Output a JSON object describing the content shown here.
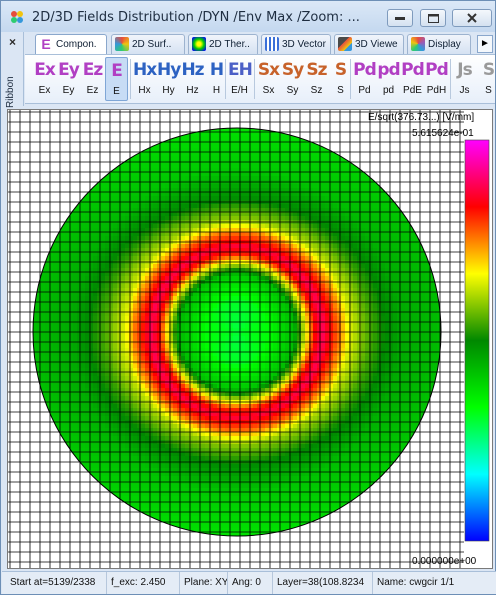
{
  "window": {
    "title": "2D/3D Fields Distribution /DYN /Env Max /Zoom: ..."
  },
  "ribbon": {
    "label": "Ribbon",
    "close": "×",
    "tabs": [
      {
        "label": "Compon.",
        "icon": "e-component-icon",
        "active": true
      },
      {
        "label": "2D Surf..",
        "icon": "surface-2d-icon",
        "active": false
      },
      {
        "label": "2D Ther..",
        "icon": "thermal-2d-icon",
        "active": false
      },
      {
        "label": "3D Vector",
        "icon": "vector-3d-icon",
        "active": false
      },
      {
        "label": "3D Viewe",
        "icon": "viewer-3d-icon",
        "active": false
      },
      {
        "label": "Display",
        "icon": "display-icon",
        "active": false
      }
    ],
    "tab_scroll": "►",
    "buttons": [
      {
        "glyph": "Ex",
        "label": "Ex",
        "kind": "e",
        "selected": false
      },
      {
        "glyph": "Ey",
        "label": "Ey",
        "kind": "e",
        "selected": false
      },
      {
        "glyph": "Ez",
        "label": "Ez",
        "kind": "e",
        "selected": false
      },
      {
        "glyph": "E",
        "label": "E",
        "kind": "e",
        "selected": true
      },
      {
        "glyph": "Hx",
        "label": "Hx",
        "kind": "h",
        "selected": false
      },
      {
        "glyph": "Hy",
        "label": "Hy",
        "kind": "h",
        "selected": false
      },
      {
        "glyph": "Hz",
        "label": "Hz",
        "kind": "h",
        "selected": false
      },
      {
        "glyph": "H",
        "label": "H",
        "kind": "h",
        "selected": false
      },
      {
        "glyph": "EH",
        "label": "E/H",
        "kind": "eh",
        "selected": false
      },
      {
        "glyph": "Sx",
        "label": "Sx",
        "kind": "s",
        "selected": false
      },
      {
        "glyph": "Sy",
        "label": "Sy",
        "kind": "s",
        "selected": false
      },
      {
        "glyph": "Sz",
        "label": "Sz",
        "kind": "s",
        "selected": false
      },
      {
        "glyph": "S",
        "label": "S",
        "kind": "s",
        "selected": false
      },
      {
        "glyph": "Pd",
        "label": "Pd",
        "kind": "p",
        "selected": false
      },
      {
        "glyph": "pd",
        "label": "pd",
        "kind": "p",
        "selected": false
      },
      {
        "glyph": "Pd",
        "label": "PdE",
        "kind": "p",
        "selected": false
      },
      {
        "glyph": "Pd",
        "label": "PdH",
        "kind": "p",
        "selected": false
      },
      {
        "glyph": "Js",
        "label": "Js",
        "kind": "j",
        "selected": false
      },
      {
        "glyph": "S",
        "label": "S",
        "kind": "j",
        "selected": false
      }
    ]
  },
  "plot": {
    "colorbar_title": "E/sqrt(376.73...) [V/mm]",
    "colorbar_max": "5.615624e-01",
    "colorbar_min": "0.000000e+00"
  },
  "chart_data": {
    "type": "heatmap",
    "title": "",
    "colorbar_label": "E/sqrt(376.73...) [V/mm]",
    "range": [
      0.0,
      0.5615624
    ],
    "colormap": [
      "#0000ff",
      "#00ffff",
      "#00ff00",
      "#008800",
      "#ffff00",
      "#ff0000",
      "#ff00ff"
    ],
    "field_shape": "circular aperture",
    "radial_profile": {
      "r_fraction": [
        0.0,
        0.15,
        0.28,
        0.33,
        0.38,
        0.42,
        0.48,
        0.55,
        0.65,
        0.8,
        1.0
      ],
      "value_fraction": [
        0.3,
        0.32,
        0.42,
        0.62,
        0.82,
        0.88,
        0.78,
        0.62,
        0.52,
        0.43,
        0.4
      ]
    }
  },
  "status": {
    "start": "Start at=5139/2338",
    "fexc": "f_exc: 2.450",
    "plane": "Plane: XY",
    "ang": "Ang: 0",
    "layer": "Layer=38(108.8234",
    "name": "Name: cwgcir 1/1"
  }
}
